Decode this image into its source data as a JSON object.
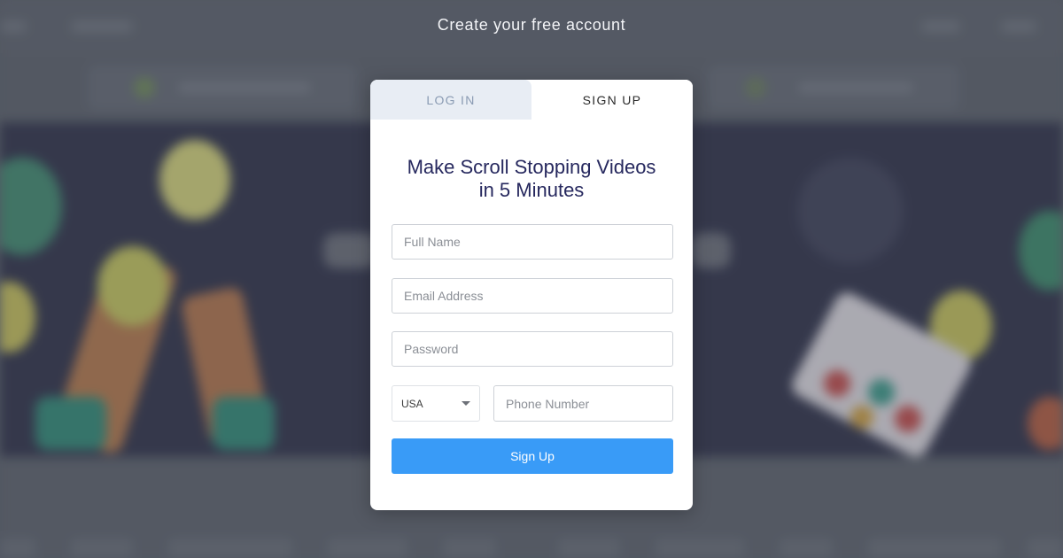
{
  "modal": {
    "heading": "Create your free account",
    "tabs": [
      {
        "label": "LOG IN",
        "active": false
      },
      {
        "label": "SIGN UP",
        "active": true
      }
    ],
    "tagline_line1": "Make Scroll Stopping Videos",
    "tagline_line2": "in 5 Minutes",
    "fields": {
      "full_name": {
        "placeholder": "Full Name",
        "value": ""
      },
      "email": {
        "placeholder": "Email Address",
        "value": ""
      },
      "password": {
        "placeholder": "Password",
        "value": ""
      },
      "country": {
        "selected": "USA"
      },
      "phone": {
        "placeholder": "Phone Number",
        "value": ""
      }
    },
    "submit_label": "Sign Up"
  },
  "colors": {
    "accent": "#399bf7",
    "tagline": "#26285e",
    "inactive_tab_bg": "#e8edf4",
    "inactive_tab_text": "#8a9bb3"
  }
}
